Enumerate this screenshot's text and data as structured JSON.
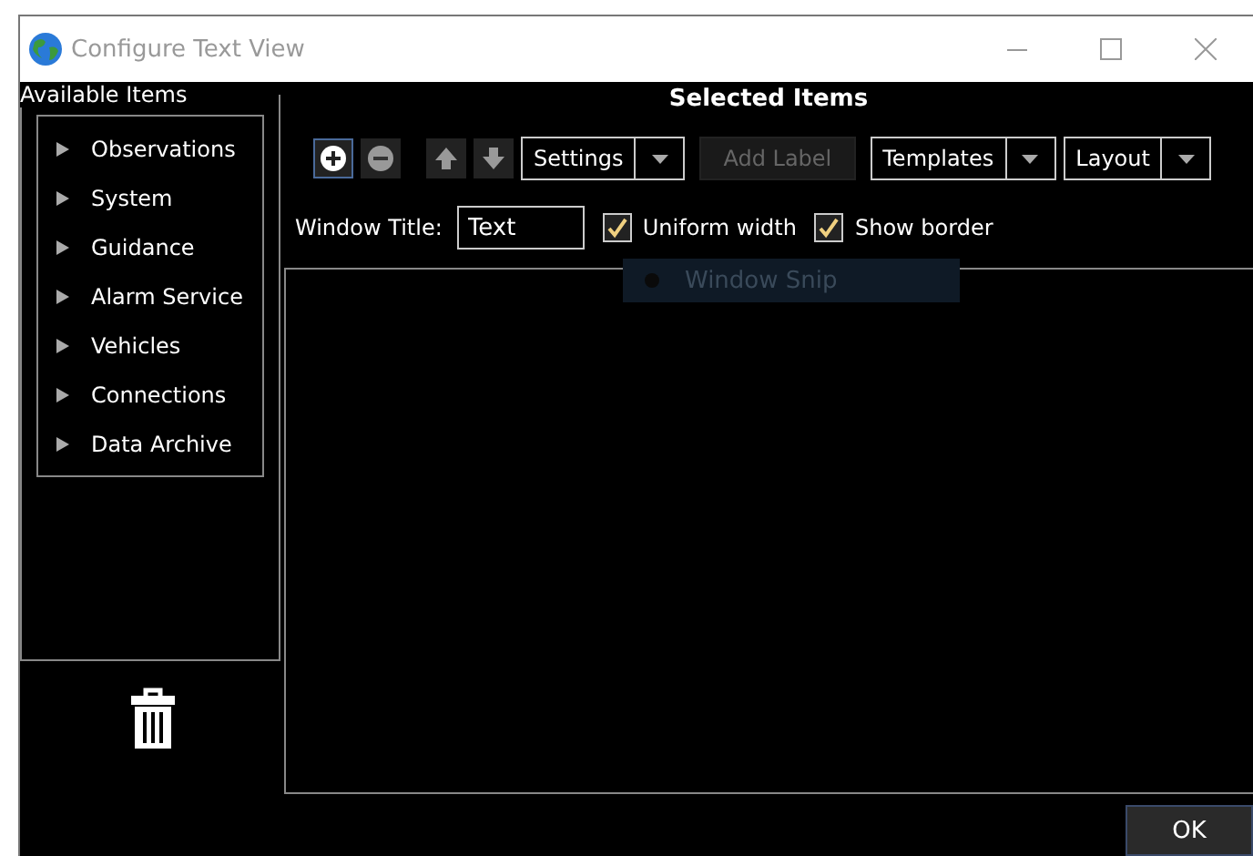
{
  "window": {
    "title": "Configure Text View"
  },
  "available_items": {
    "title": "Available Items",
    "items": [
      {
        "label": "Observations"
      },
      {
        "label": "System"
      },
      {
        "label": "Guidance"
      },
      {
        "label": "Alarm Service"
      },
      {
        "label": "Vehicles"
      },
      {
        "label": "Connections"
      },
      {
        "label": "Data Archive"
      }
    ]
  },
  "selected_items": {
    "title": "Selected Items",
    "toolbar": [
      {
        "kind": "icon",
        "selected": true
      },
      {
        "kind": "icon",
        "selected": false
      },
      {
        "kind": "icon",
        "selected": false
      },
      {
        "kind": "icon",
        "selected": false
      },
      {
        "kind": "split",
        "label": "Settings"
      },
      {
        "kind": "button",
        "label": "Add Label",
        "disabled": true
      },
      {
        "kind": "split",
        "label": "Templates"
      },
      {
        "kind": "split",
        "label": "Layout"
      }
    ],
    "window_title_label": "Window Title:",
    "window_title_value": "Text",
    "options": [
      {
        "label": "Uniform width",
        "checked": true
      },
      {
        "label": "Show border",
        "checked": true
      }
    ],
    "overlay_label": "Window Snip"
  },
  "buttons": [
    {
      "label": "OK"
    }
  ]
}
